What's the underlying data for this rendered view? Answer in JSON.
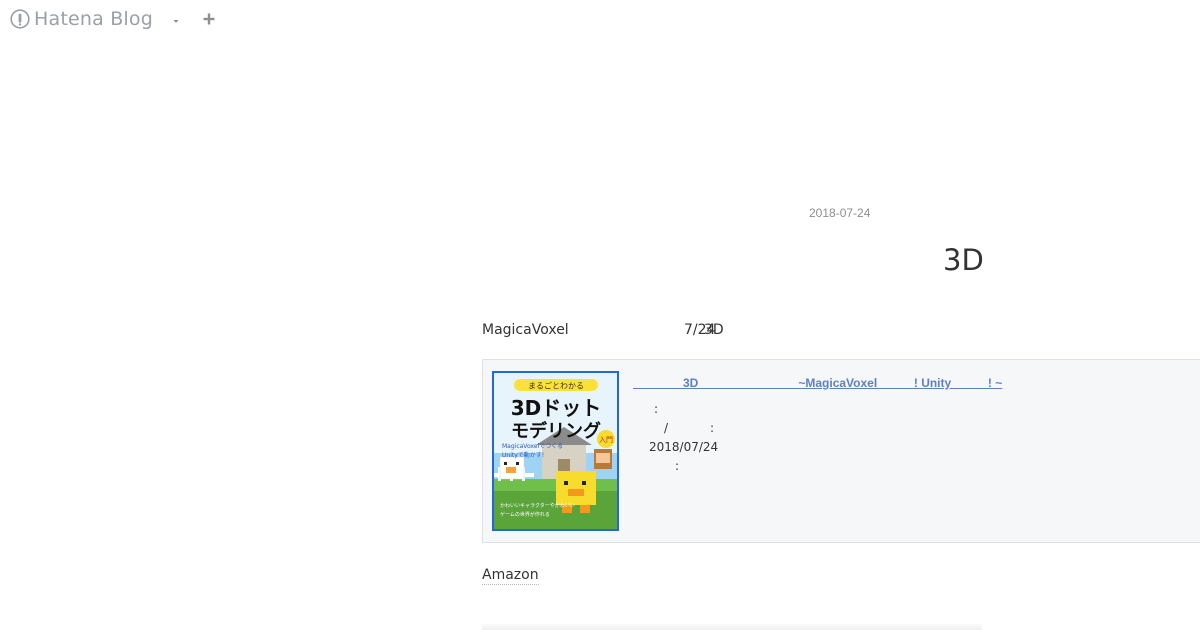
{
  "header": {
    "logo_text": "Hatena Blog",
    "logo_icon": "hatena-blog-icon",
    "menu_icon": "caret-down-icon",
    "add_icon": "plus-icon"
  },
  "entry": {
    "date": "2018-07-24",
    "title": "3D",
    "body_text_1": "MagicaVoxel",
    "body_text_2": "7/24",
    "body_text_3": "3D"
  },
  "product": {
    "title_link": "               3D                              ~MagicaVoxel           ! Unity           ! ~",
    "detail_1": ":",
    "detail_2": "/           :",
    "detail_3": "2018/07/24",
    "detail_4": ":",
    "cover_text": {
      "ribbon": "まるごとわかる",
      "main_1": "3Dドット",
      "main_2": "モデリング",
      "badge": "入門",
      "sub_1": "MagicaVoxelでつくる",
      "sub_2": "Unityで動かす!",
      "tag_1": "かわいいキャラクターやかわいい",
      "tag_2": "ゲームの世界が作れる"
    }
  },
  "amazon_label": "Amazon",
  "colors": {
    "link": "#5f7fc0",
    "card_bg": "#f6f7f9",
    "cover_border": "#1f6ad8"
  }
}
